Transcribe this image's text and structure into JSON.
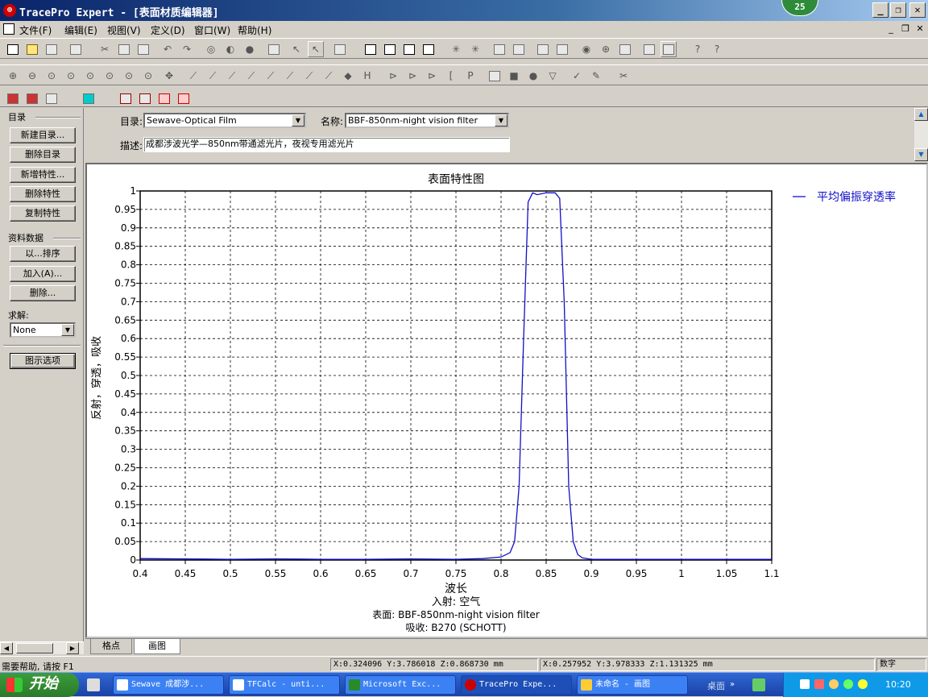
{
  "window": {
    "title": "TracePro Expert - [表面材质编辑器]",
    "badge": "25",
    "controls": {
      "minimize": "_",
      "restore": "❐",
      "close": "✕"
    },
    "mdi_controls": {
      "minimize": "_",
      "restore": "❐",
      "close": "✕"
    }
  },
  "menu": [
    "文件(F)",
    "编辑(E)",
    "视图(V)",
    "定义(D)",
    "窗口(W)",
    "帮助(H)"
  ],
  "left_panel": {
    "catalog_group": "目录",
    "new_catalog": "新建目录...",
    "delete_catalog": "删除目录",
    "add_property": "新增特性...",
    "delete_property": "删除特性",
    "copy_property": "复制特性",
    "data_group": "资料数据",
    "sort_by": "以...排序",
    "add": "加入(A)...",
    "delete": "删除...",
    "solve_label": "求解:",
    "solve_value": "None",
    "plot_options": "图示选项"
  },
  "form": {
    "catalog_label": "目录:",
    "catalog_value": "Sewave-Optical Film",
    "name_label": "名称:",
    "name_value": "BBF-850nm-night vision filter",
    "desc_label": "描述:",
    "desc_value": "成都涉波光学—850nm带通滤光片，夜视专用滤光片"
  },
  "chart_data": {
    "type": "line",
    "title": "表面特性图",
    "xlabel": "波长",
    "ylabel": "反射，穿透，吸收",
    "xlim": [
      0.4,
      1.1
    ],
    "ylim": [
      0,
      1
    ],
    "xticks": [
      "0.4",
      "0.45",
      "0.5",
      "0.55",
      "0.6",
      "0.65",
      "0.7",
      "0.75",
      "0.8",
      "0.85",
      "0.9",
      "0.95",
      "1",
      "1.05",
      "1.1"
    ],
    "yticks": [
      "0",
      "0.05",
      "0.1",
      "0.15",
      "0.2",
      "0.25",
      "0.3",
      "0.35",
      "0.4",
      "0.45",
      "0.5",
      "0.55",
      "0.6",
      "0.65",
      "0.7",
      "0.75",
      "0.8",
      "0.85",
      "0.9",
      "0.95",
      "1"
    ],
    "grid": true,
    "legend_position": "top-right",
    "series": [
      {
        "name": "平均偏振穿透率",
        "color": "#1010c8",
        "x": [
          0.4,
          0.45,
          0.5,
          0.55,
          0.6,
          0.65,
          0.7,
          0.75,
          0.78,
          0.8,
          0.81,
          0.815,
          0.82,
          0.825,
          0.83,
          0.835,
          0.84,
          0.85,
          0.86,
          0.865,
          0.87,
          0.875,
          0.88,
          0.885,
          0.89,
          0.9,
          0.95,
          1.0,
          1.05,
          1.1
        ],
        "y": [
          0.004,
          0.003,
          0.002,
          0.003,
          0.002,
          0.002,
          0.003,
          0.002,
          0.004,
          0.008,
          0.02,
          0.05,
          0.2,
          0.6,
          0.97,
          0.995,
          0.99,
          0.995,
          0.995,
          0.98,
          0.7,
          0.2,
          0.05,
          0.015,
          0.006,
          0.002,
          0.002,
          0.002,
          0.002,
          0.002
        ]
      }
    ],
    "footer": {
      "incident": "入射: 空气",
      "surface": "表面: BBF-850nm-night vision filter",
      "absorption": "吸收: B270 (SCHOTT)"
    }
  },
  "tabs": [
    "格点",
    "画图"
  ],
  "status": {
    "help": "需要帮助, 请按 F1",
    "coord1": "X:0.324096 Y:3.786018 Z:0.868730 mm",
    "coord2": "X:0.257952 Y:3.978333 Z:1.131325 mm",
    "numlock": "数字"
  },
  "taskbar": {
    "start": "开始",
    "tasks": [
      "Sewave 成都涉...",
      "TFCalc - unti...",
      "Microsoft Exc...",
      "TracePro Expe...",
      "未命名 - 画图"
    ],
    "desktop": "桌面",
    "clock": "10:20"
  }
}
